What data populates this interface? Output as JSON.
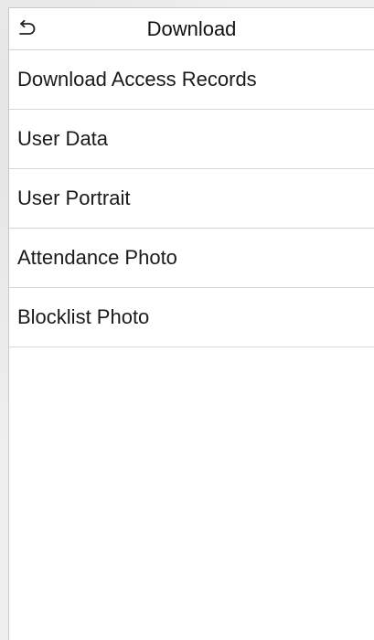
{
  "header": {
    "title": "Download",
    "back_icon": "back-arrow-icon"
  },
  "menu": {
    "items": [
      {
        "label": "Download Access Records"
      },
      {
        "label": "User Data"
      },
      {
        "label": "User Portrait"
      },
      {
        "label": "Attendance Photo"
      },
      {
        "label": "Blocklist Photo"
      }
    ]
  },
  "colors": {
    "background": "#ffffff",
    "divider": "#d6d6d6",
    "text": "#1a1a1a"
  }
}
